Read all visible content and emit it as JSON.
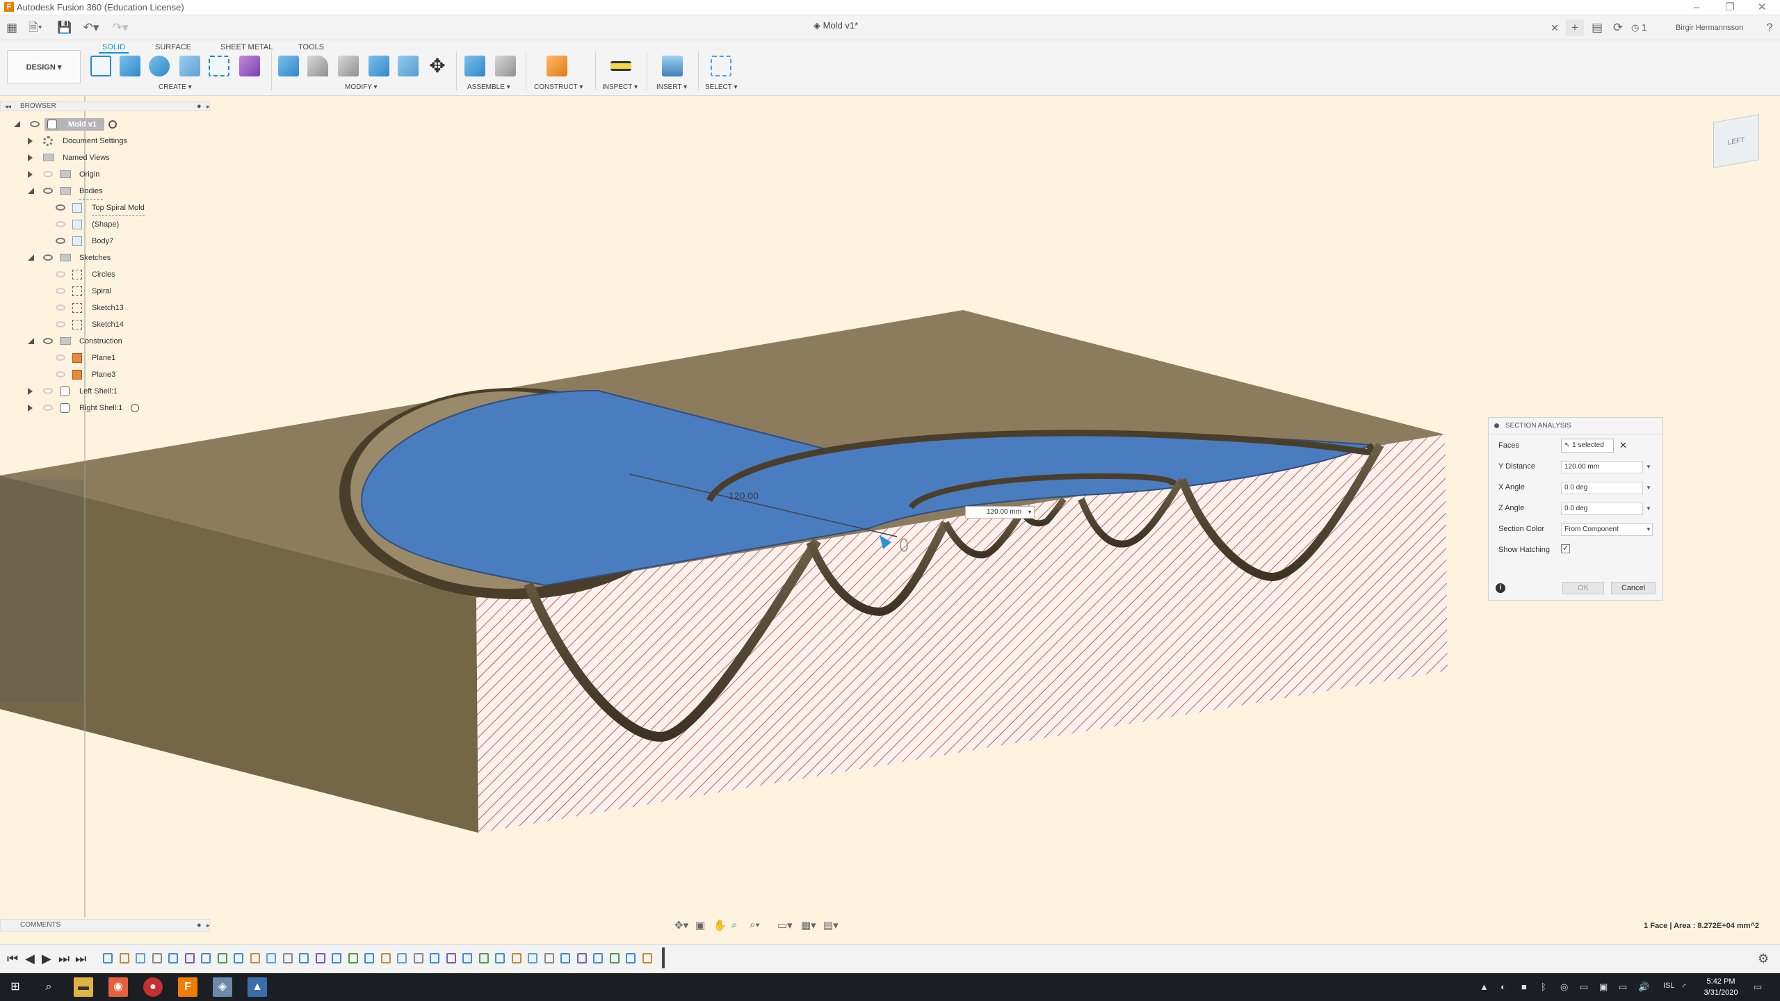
{
  "window": {
    "title": "Autodesk Fusion 360 (Education License)"
  },
  "appbar": {
    "doc_tab": "Mold v1*",
    "jobs_count": "1",
    "user": "Birgir Hermannsson"
  },
  "ribbon": {
    "workspace": "DESIGN ▾",
    "tabs": [
      "SOLID",
      "SURFACE",
      "SHEET METAL",
      "TOOLS"
    ],
    "groups": [
      "CREATE ▾",
      "MODIFY ▾",
      "ASSEMBLE ▾",
      "CONSTRUCT ▾",
      "INSPECT ▾",
      "INSERT ▾",
      "SELECT ▾"
    ]
  },
  "browser": {
    "title": "BROWSER",
    "root": "Mold v1",
    "items": [
      {
        "label": "Document Settings"
      },
      {
        "label": "Named Views"
      },
      {
        "label": "Origin"
      },
      {
        "label": "Bodies"
      },
      {
        "label": "Top Spiral Mold"
      },
      {
        "label": "(Shape)"
      },
      {
        "label": "Body7"
      },
      {
        "label": "Sketches"
      },
      {
        "label": "Circles"
      },
      {
        "label": "Spiral"
      },
      {
        "label": "Sketch13"
      },
      {
        "label": "Sketch14"
      },
      {
        "label": "Construction"
      },
      {
        "label": "Plane1"
      },
      {
        "label": "Plane3"
      },
      {
        "label": "Left Shell:1"
      },
      {
        "label": "Right Shell:1"
      }
    ]
  },
  "viewport": {
    "dimension_text": "120.00",
    "dimension_input": "120.00 mm",
    "navcube_face": "LEFT"
  },
  "section_analysis": {
    "title": "SECTION ANALYSIS",
    "faces_label": "Faces",
    "faces_value": "1 selected",
    "y_distance_label": "Y Distance",
    "y_distance_value": "120.00 mm",
    "x_angle_label": "X Angle",
    "x_angle_value": "0.0 deg",
    "z_angle_label": "Z Angle",
    "z_angle_value": "0.0 deg",
    "section_color_label": "Section Color",
    "section_color_value": "From Component",
    "show_hatching_label": "Show Hatching",
    "show_hatching": true,
    "ok": "OK",
    "cancel": "Cancel"
  },
  "comments": {
    "label": "COMMENTS"
  },
  "status": {
    "text": "1 Face | Area : 8.272E+04 mm^2"
  },
  "taskbar": {
    "time": "5:42 PM",
    "date": "3/31/2020",
    "lang": "ISL"
  },
  "colors": {
    "accent": "#0696d7",
    "face_blue": "#4a7cc0",
    "mold_tan": "#8a7a5c",
    "hatch_red": "#b33a44",
    "canvas": "#fdf3df"
  }
}
